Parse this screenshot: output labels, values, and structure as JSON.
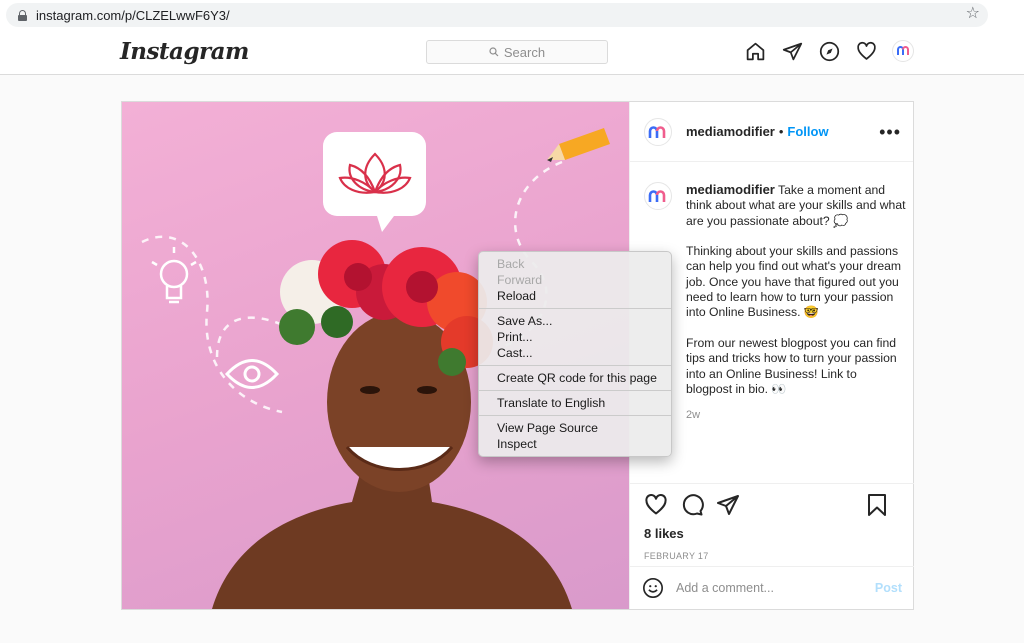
{
  "browser": {
    "url": "instagram.com/p/CLZELwwF6Y3/"
  },
  "header": {
    "logo": "Instagram",
    "search_placeholder": "Search",
    "nav": [
      "home-icon",
      "direct-icon",
      "explore-icon",
      "activity-heart-icon",
      "profile-avatar"
    ]
  },
  "post": {
    "username": "mediamodifier",
    "follow": "Follow",
    "separator": "•",
    "caption_paragraphs": [
      "Take a moment and think about what are your skills and what are you passionate about? 💭",
      "Thinking about your skills and passions can help you find out what's your dream job. Once you have that figured out you need to learn how to turn your passion into Online Business. 🤓",
      "From our newest blogpost you can find tips and tricks how to turn your passion into an Online Business! Link to blogpost in bio. 👀"
    ],
    "time_ago": "2w",
    "likes": "8 likes",
    "date": "FEBRUARY 17",
    "comment_placeholder": "Add a comment...",
    "post_button": "Post"
  },
  "context_menu": {
    "groups": [
      [
        {
          "label": "Back",
          "enabled": false
        },
        {
          "label": "Forward",
          "enabled": false
        },
        {
          "label": "Reload",
          "enabled": true
        }
      ],
      [
        {
          "label": "Save As...",
          "enabled": true
        },
        {
          "label": "Print...",
          "enabled": true
        },
        {
          "label": "Cast...",
          "enabled": true
        }
      ],
      [
        {
          "label": "Create QR code for this page",
          "enabled": true
        }
      ],
      [
        {
          "label": "Translate to English",
          "enabled": true
        }
      ],
      [
        {
          "label": "View Page Source",
          "enabled": true
        },
        {
          "label": "Inspect",
          "enabled": true
        }
      ]
    ]
  },
  "colors": {
    "link": "#0095f6",
    "post_disabled": "#b2dffc",
    "photo_bg": "#e9a3ce",
    "brand_blue": "#3b6cf6",
    "brand_pink": "#f05d8d"
  }
}
